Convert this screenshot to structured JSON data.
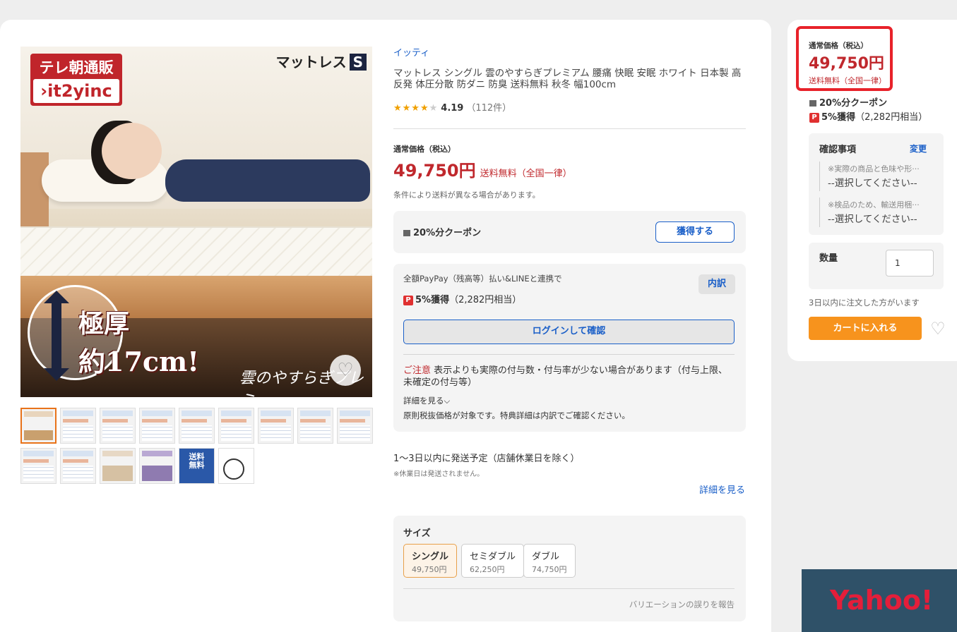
{
  "main_image": {
    "tv_channel": "テレ朝通販",
    "brand_logo": "›it2yinc",
    "product_type": "マットレス",
    "size_badge": "S",
    "thickness_line1": "極厚",
    "thickness_line2": "約17cm!",
    "series_script": "雲のやすらぎプレミ",
    "favorite_icon": "heart-icon"
  },
  "thumbnails": {
    "truck_label": "送料\n無料"
  },
  "product": {
    "shop_name": "イッティ",
    "title": "マットレス シングル 雲のやすらぎプレミアム 腰痛 快眠 安眠 ホワイト 日本製 高反発 体圧分散 防ダニ 防臭 送料無料 秋冬 幅100cm",
    "stars_on": "★★★★",
    "stars_off": "★",
    "rating": "4.19",
    "review_count": "（112件）"
  },
  "price": {
    "label": "通常価格（税込）",
    "amount": "49,750円",
    "shipping": "送料無料（全国一律）",
    "shipping_note": "条件により送料が異なる場合があります。"
  },
  "coupon": {
    "text": "20%分クーポン",
    "button": "獲得する"
  },
  "paypay": {
    "intro": "全額PayPay（残高等）払い&LINEと連携で",
    "detail_button": "内訳",
    "earn_bold": "5%獲得",
    "earn_amount": "（2,282円相当）",
    "login_button": "ログインして確認",
    "notice_label": "ご注意",
    "notice_text": " 表示よりも実際の付与数・付与率が少ない場合があります（付与上限、未確定の付与等）",
    "see_more": "詳細を見る⌵",
    "tax_note": "原則税抜価格が対象です。特典詳細は内訳でご確認ください。"
  },
  "delivery": {
    "text": "1〜3日以内に発送予定（店舗休業日を除く）",
    "holiday_note": "※休業日は発送されません。",
    "detail_link": "詳細を見る"
  },
  "size": {
    "title": "サイズ",
    "options": [
      {
        "name": "シングル",
        "price": "49,750円",
        "selected": true
      },
      {
        "name": "セミダブル",
        "price": "62,250円",
        "selected": false
      },
      {
        "name": "ダブル",
        "price": "74,750円",
        "selected": false
      }
    ],
    "report_link": "バリエーションの誤りを報告"
  },
  "sidebar": {
    "price_label": "通常価格（税込）",
    "price": "49,750円",
    "shipping": "送料無料（全国一律）",
    "coupon": "20%分クーポン",
    "earn_bold": "5%獲得",
    "earn_amount": "（2,282円相当）",
    "confirm_title": "確認事項",
    "change_link": "変更",
    "confirm_items": [
      {
        "note": "※実際の商品と色味や形···",
        "select": "--選択してください--"
      },
      {
        "note": "※検品のため、輸送用梱···",
        "select": "--選択してください--"
      }
    ],
    "quantity_label": "数量",
    "quantity_value": "1",
    "recent_order": "3日以内に注文した方がいます",
    "cart_button": "カートに入れる",
    "favorite_icon": "heart-icon"
  },
  "watermark": "Yahoo!",
  "colors": {
    "price_red": "#c0282d",
    "link_blue": "#1a5fc8",
    "cart_orange": "#f7931d",
    "highlight_red": "#e8222a"
  }
}
